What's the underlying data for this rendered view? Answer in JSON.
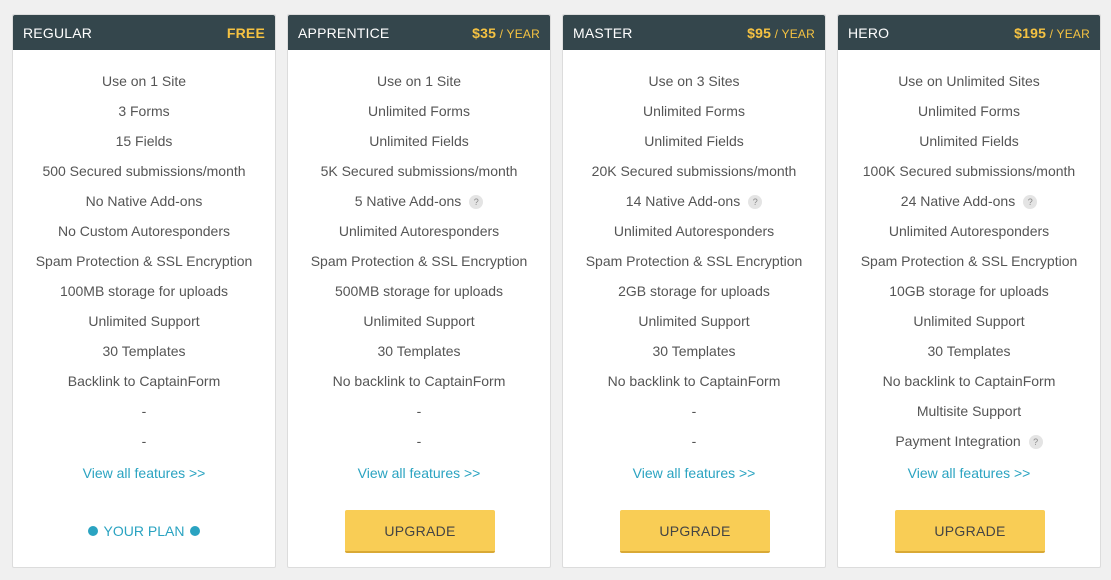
{
  "plans": [
    {
      "name": "REGULAR",
      "price": "FREE",
      "period": "",
      "features": [
        {
          "text": "Use on 1 Site",
          "help": false
        },
        {
          "text": "3 Forms",
          "help": false
        },
        {
          "text": "15 Fields",
          "help": false
        },
        {
          "text": "500 Secured submissions/month",
          "help": false
        },
        {
          "text": "No Native Add-ons",
          "help": false
        },
        {
          "text": "No Custom Autoresponders",
          "help": false
        },
        {
          "text": "Spam Protection & SSL Encryption",
          "help": false
        },
        {
          "text": "100MB storage for uploads",
          "help": false
        },
        {
          "text": "Unlimited Support",
          "help": false
        },
        {
          "text": "30 Templates",
          "help": false
        },
        {
          "text": "Backlink to CaptainForm",
          "help": false
        },
        {
          "text": "-",
          "help": false
        },
        {
          "text": "-",
          "help": false
        }
      ],
      "view_all": "View all features >>",
      "action": {
        "type": "current",
        "label": "YOUR PLAN"
      }
    },
    {
      "name": "APPRENTICE",
      "price": "$35",
      "period": " / YEAR",
      "features": [
        {
          "text": "Use on 1 Site",
          "help": false
        },
        {
          "text": "Unlimited Forms",
          "help": false
        },
        {
          "text": "Unlimited Fields",
          "help": false
        },
        {
          "text": "5K Secured submissions/month",
          "help": false
        },
        {
          "text": "5 Native Add-ons",
          "help": true
        },
        {
          "text": "Unlimited Autoresponders",
          "help": false
        },
        {
          "text": "Spam Protection & SSL Encryption",
          "help": false
        },
        {
          "text": "500MB storage for uploads",
          "help": false
        },
        {
          "text": "Unlimited Support",
          "help": false
        },
        {
          "text": "30 Templates",
          "help": false
        },
        {
          "text": "No backlink to CaptainForm",
          "help": false
        },
        {
          "text": "-",
          "help": false
        },
        {
          "text": "-",
          "help": false
        }
      ],
      "view_all": "View all features >>",
      "action": {
        "type": "upgrade",
        "label": "UPGRADE"
      }
    },
    {
      "name": "MASTER",
      "price": "$95",
      "period": " / YEAR",
      "features": [
        {
          "text": "Use on 3 Sites",
          "help": false
        },
        {
          "text": "Unlimited Forms",
          "help": false
        },
        {
          "text": "Unlimited Fields",
          "help": false
        },
        {
          "text": "20K Secured submissions/month",
          "help": false
        },
        {
          "text": "14 Native Add-ons",
          "help": true
        },
        {
          "text": "Unlimited Autoresponders",
          "help": false
        },
        {
          "text": "Spam Protection & SSL Encryption",
          "help": false
        },
        {
          "text": "2GB storage for uploads",
          "help": false
        },
        {
          "text": "Unlimited Support",
          "help": false
        },
        {
          "text": "30 Templates",
          "help": false
        },
        {
          "text": "No backlink to CaptainForm",
          "help": false
        },
        {
          "text": "-",
          "help": false
        },
        {
          "text": "-",
          "help": false
        }
      ],
      "view_all": "View all features >>",
      "action": {
        "type": "upgrade",
        "label": "UPGRADE"
      }
    },
    {
      "name": "HERO",
      "price": "$195",
      "period": " / YEAR",
      "features": [
        {
          "text": "Use on Unlimited Sites",
          "help": false
        },
        {
          "text": "Unlimited Forms",
          "help": false
        },
        {
          "text": "Unlimited Fields",
          "help": false
        },
        {
          "text": "100K Secured submissions/month",
          "help": false
        },
        {
          "text": "24 Native Add-ons",
          "help": true
        },
        {
          "text": "Unlimited Autoresponders",
          "help": false
        },
        {
          "text": "Spam Protection & SSL Encryption",
          "help": false
        },
        {
          "text": "10GB storage for uploads",
          "help": false
        },
        {
          "text": "Unlimited Support",
          "help": false
        },
        {
          "text": "30 Templates",
          "help": false
        },
        {
          "text": "No backlink to CaptainForm",
          "help": false
        },
        {
          "text": "Multisite Support",
          "help": false
        },
        {
          "text": "Payment Integration",
          "help": true
        }
      ],
      "view_all": "View all features >>",
      "action": {
        "type": "upgrade",
        "label": "UPGRADE"
      }
    }
  ],
  "help_glyph": "?",
  "icons": {
    "help": "question-circle-icon",
    "plan_dot": "dot-icon"
  },
  "colors": {
    "header_bg": "#34464c",
    "price": "#f5c242",
    "link": "#2aa3c1",
    "upgrade_button": "#f9cd55",
    "feature_text": "#555555"
  }
}
